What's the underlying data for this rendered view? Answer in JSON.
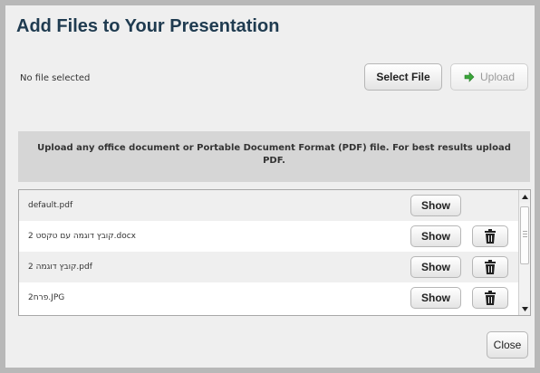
{
  "dialog": {
    "title": "Add Files to Your Presentation",
    "no_file_text": "No file selected",
    "select_label": "Select File",
    "upload_label": "Upload",
    "info_text": "Upload any office document or Portable Document Format (PDF) file.  For best results upload PDF.",
    "close_label": "Close"
  },
  "files": [
    {
      "name": "default.pdf",
      "show_label": "Show",
      "deletable": false
    },
    {
      "name": "קובץ דוגמה עם טקסט 2.docx",
      "show_label": "Show",
      "deletable": true
    },
    {
      "name": "קובץ דוגמה 2.pdf",
      "show_label": "Show",
      "deletable": true
    },
    {
      "name": "פרח2.JPG",
      "show_label": "Show",
      "deletable": true
    }
  ],
  "icons": {
    "upload": "arrow-right-icon",
    "delete": "trash-icon",
    "scroll_up": "scroll-up-icon",
    "scroll_down": "scroll-down-icon"
  },
  "colors": {
    "title": "#1f3b50",
    "upload_arrow": "#3aa53a"
  }
}
